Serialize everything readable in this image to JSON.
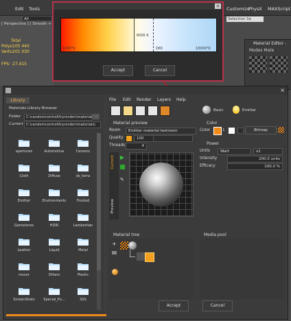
{
  "bg": {
    "menu": [
      "Edit",
      "Tools",
      "Customize",
      "PhysX",
      "MAXScript"
    ],
    "filter_value": "All",
    "viewport_label": "[ Perspective ] [ Smooth + ...",
    "stats": {
      "total_label": "Total",
      "polys_label": "Polys:",
      "polys_value": "105 440",
      "verts_label": "Verts:",
      "verts_value": "201 030",
      "fps_label": "FPS:",
      "fps_value": "27.415"
    },
    "selection_set": "Selection Se"
  },
  "color_dialog": {
    "temp_label": "6000 K",
    "left_label": "1000°K",
    "mid_label": "D65",
    "right_label": "10000°K",
    "accept": "Accept",
    "cancel": "Cancel"
  },
  "material_editor": {
    "title": "Material Editor -",
    "menu": "Modes  Mate"
  },
  "library": {
    "tab": "Library",
    "header": "Materials Library Browser",
    "folder_label": "Folder",
    "folder_value": "C:\\randomcontrol\\fryrender\\materials",
    "current_label": "Current",
    "current_value": "C:\\randomcontrol\\fryrender\\materials\\",
    "items": [
      "apertures",
      "Automotive",
      "Ceramic",
      "Cloth",
      "Diffuse",
      "ds_terra",
      "Emitter",
      "Environments",
      "Frosted",
      "Gemstones",
      "HDRI",
      "Lambertian",
      "Leather",
      "Liquid",
      "Metal",
      "musor",
      "Others",
      "Plastic",
      "ScreenShots",
      "Special_Pu...",
      "SSS"
    ]
  },
  "editor": {
    "menu": [
      "File",
      "Edit",
      "Render",
      "Layers",
      "Help"
    ],
    "basic": "Basic",
    "emitter": "Emitter",
    "preview_title": "Material preview",
    "room_label": "Room",
    "room_value": "Emitter material testroom",
    "quality_label": "Quality",
    "quality_value": "100",
    "threads_label": "Threads",
    "threads_value": "4",
    "current_tab": "Current",
    "preview_tab": "Preview",
    "color_section": "Color",
    "color_label": "Color",
    "color_value": "1",
    "bitmap": "Bitmap",
    "power_section": "Power",
    "units_label": "Units",
    "units_value": "Watt",
    "mult_value": "x1",
    "intensity_label": "Intensity",
    "intensity_value": "200.0 units",
    "efficacy_label": "Efficacy",
    "efficacy_value": "100.0 %",
    "tree_title": "Material tree",
    "media_title": "Media pool",
    "accept": "Accept",
    "cancel": "Cancel"
  },
  "colors": {
    "accent": "#ff9a1a",
    "highlight_border": "#b9334c"
  }
}
